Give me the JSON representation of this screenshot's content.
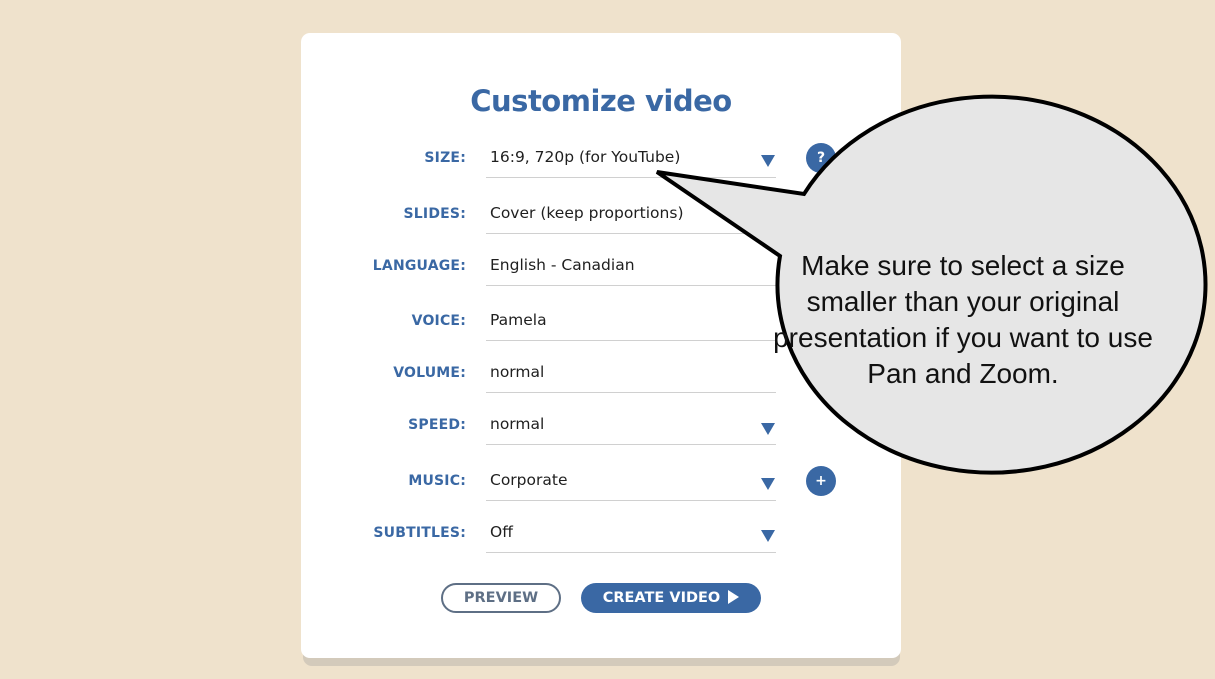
{
  "dialog": {
    "title": "Customize video"
  },
  "fields": [
    {
      "label": "SIZE:",
      "value": "16:9, 720p (for YouTube)"
    },
    {
      "label": "SLIDES:",
      "value": "Cover (keep proportions)"
    },
    {
      "label": "LANGUAGE:",
      "value": "English - Canadian"
    },
    {
      "label": "VOICE:",
      "value": "Pamela"
    },
    {
      "label": "VOLUME:",
      "value": "normal"
    },
    {
      "label": "SPEED:",
      "value": "normal"
    },
    {
      "label": "MUSIC:",
      "value": "Corporate"
    },
    {
      "label": "SUBTITLES:",
      "value": "Off"
    }
  ],
  "help_button": {
    "glyph": "?"
  },
  "add_music_button": {
    "glyph": "+"
  },
  "buttons": {
    "preview": "PREVIEW",
    "create": "CREATE VIDEO"
  },
  "callout": {
    "text": "Make sure to select a size smaller than your original presentation if you want to use Pan and Zoom."
  },
  "colors": {
    "background": "#efe2cc",
    "accent": "#3a68a4",
    "callout_fill": "#e6e6e6"
  },
  "icons": {
    "dropdown": "caret-down-icon",
    "help": "question-icon",
    "add": "plus-icon",
    "play": "play-icon"
  }
}
